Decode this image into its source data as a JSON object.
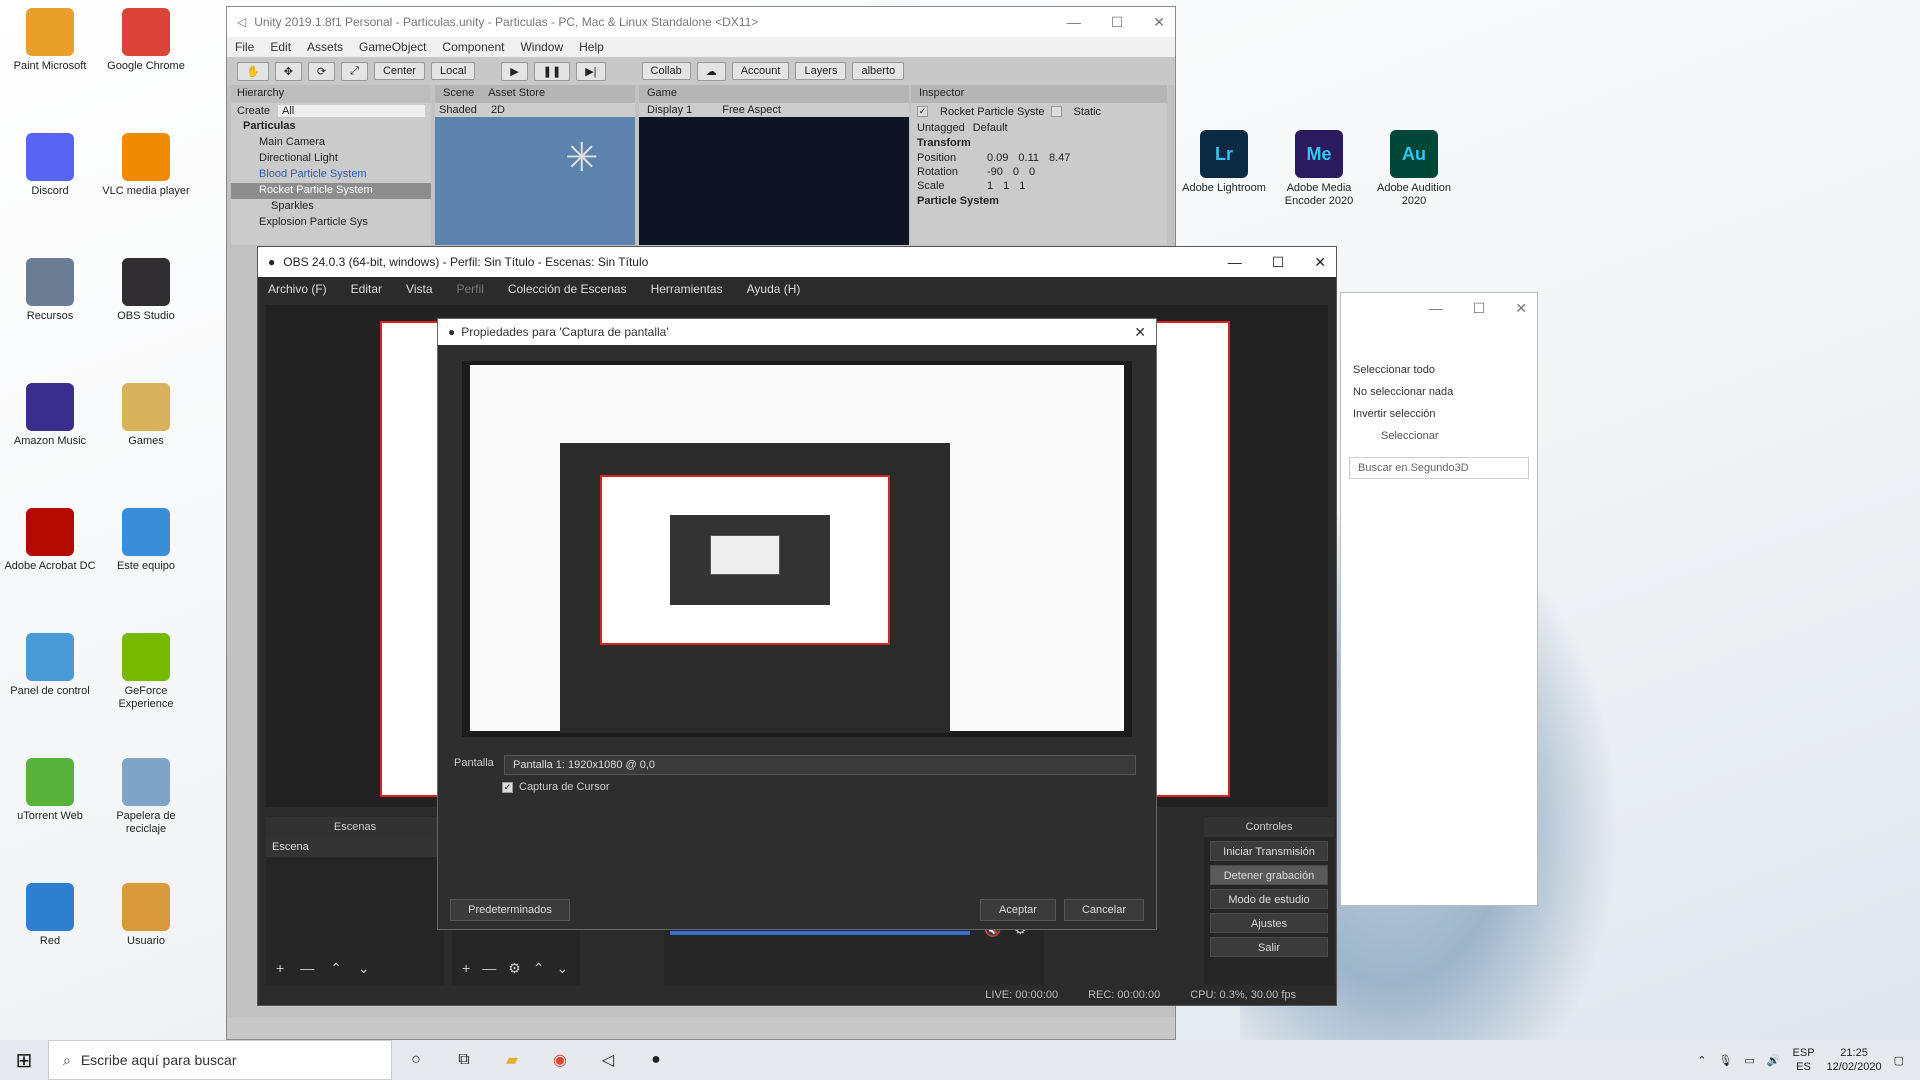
{
  "desktop_icons": [
    {
      "label": "Paint Microsoft",
      "color": "#e9a02a"
    },
    {
      "label": "Google Chrome",
      "color": "#db4437"
    },
    {
      "label": "Discord",
      "color": "#5865f2"
    },
    {
      "label": "VLC media player",
      "color": "#f08a00"
    },
    {
      "label": "Recursos",
      "color": "#6b7c93"
    },
    {
      "label": "OBS Studio",
      "color": "#302e31"
    },
    {
      "label": "Amazon Music",
      "color": "#3a2d8c"
    },
    {
      "label": "Games",
      "color": "#d8b25a"
    },
    {
      "label": "Adobe Acrobat DC",
      "color": "#b30b00"
    },
    {
      "label": "Este equipo",
      "color": "#3a8ed8"
    },
    {
      "label": "Panel de control",
      "color": "#4a9ad8"
    },
    {
      "label": "GeForce Experience",
      "color": "#76b900"
    },
    {
      "label": "uTorrent Web",
      "color": "#58b33c"
    },
    {
      "label": "Papelera de reciclaje",
      "color": "#7da5c8"
    },
    {
      "label": "Red",
      "color": "#2f7fd0"
    },
    {
      "label": "Usuario",
      "color": "#d89a3a"
    }
  ],
  "right_icons": [
    {
      "label": "Adobe Lightroom",
      "short": "Lr",
      "color": "#0b2b44"
    },
    {
      "label": "Adobe Media Encoder 2020",
      "short": "Me",
      "color": "#2a1b5e"
    },
    {
      "label": "Adobe Audition 2020",
      "short": "Au",
      "color": "#00473a"
    }
  ],
  "unity": {
    "title": "Unity 2019.1.8f1 Personal - Particulas.unity - Particulas - PC, Mac & Linux Standalone <DX11>",
    "menu": [
      "File",
      "Edit",
      "Assets",
      "GameObject",
      "Component",
      "Window",
      "Help"
    ],
    "toolbar": {
      "center": "Center",
      "local": "Local",
      "collab": "Collab",
      "account": "Account",
      "layers": "Layers",
      "layout": "alberto"
    },
    "hierarchy": {
      "tab": "Hierarchy",
      "create": "Create",
      "search": "All",
      "items": [
        "Particulas",
        "Main Camera",
        "Directional Light",
        "Blood Particle System",
        "Rocket Particle System",
        "Sparkles",
        "Explosion Particle Sys"
      ]
    },
    "scene_tab": "Scene",
    "asset_tab": "Asset Store",
    "shaded": "Shaded",
    "mode_2d": "2D",
    "game_tab": "Game",
    "display": "Display 1",
    "aspect": "Free Aspect",
    "inspector": {
      "tab": "Inspector",
      "object": "Rocket Particle Syste",
      "static": "Static",
      "tag": "Untagged",
      "layer": "Default",
      "transform": "Transform",
      "position": "Position",
      "rotation": "Rotation",
      "scale": "Scale",
      "pos": [
        "0.09",
        "0.11",
        "8.47"
      ],
      "rot": [
        "-90",
        "0",
        "0"
      ],
      "scl": [
        "1",
        "1",
        "1"
      ],
      "particle": "Particle System"
    }
  },
  "explorer": {
    "items": [
      "Seleccionar todo",
      "No seleccionar nada",
      "Invertir selección",
      "Seleccionar"
    ],
    "search": "Buscar en Segundo3D"
  },
  "obs": {
    "title": "OBS 24.0.3 (64-bit, windows) - Perfil: Sin Título - Escenas: Sin Título",
    "menu": [
      "Archivo (F)",
      "Editar",
      "Vista",
      "Perfil",
      "Colección de Escenas",
      "Herramientas",
      "Ayuda (H)"
    ],
    "scenes_title": "Escenas",
    "scene_item": "Escena",
    "controls_title": "Controles",
    "controls": [
      "Iniciar Transmisión",
      "Detener grabación",
      "Modo de estudio",
      "Ajustes",
      "Salir"
    ],
    "status": {
      "live": "LIVE: 00:00:00",
      "rec": "REC: 00:00:00",
      "cpu": "CPU: 0.3%, 30.00 fps"
    }
  },
  "dialog": {
    "title": "Propiedades para 'Captura de pantalla'",
    "screen_label": "Pantalla",
    "screen_value": "Pantalla 1: 1920x1080 @ 0,0",
    "cursor_label": "Captura de Cursor",
    "defaults": "Predeterminados",
    "accept": "Aceptar",
    "cancel": "Cancelar"
  },
  "taskbar": {
    "search_placeholder": "Escribe aquí para buscar",
    "lang": "ESP",
    "lang2": "ES",
    "time": "21:25",
    "date": "12/02/2020"
  }
}
